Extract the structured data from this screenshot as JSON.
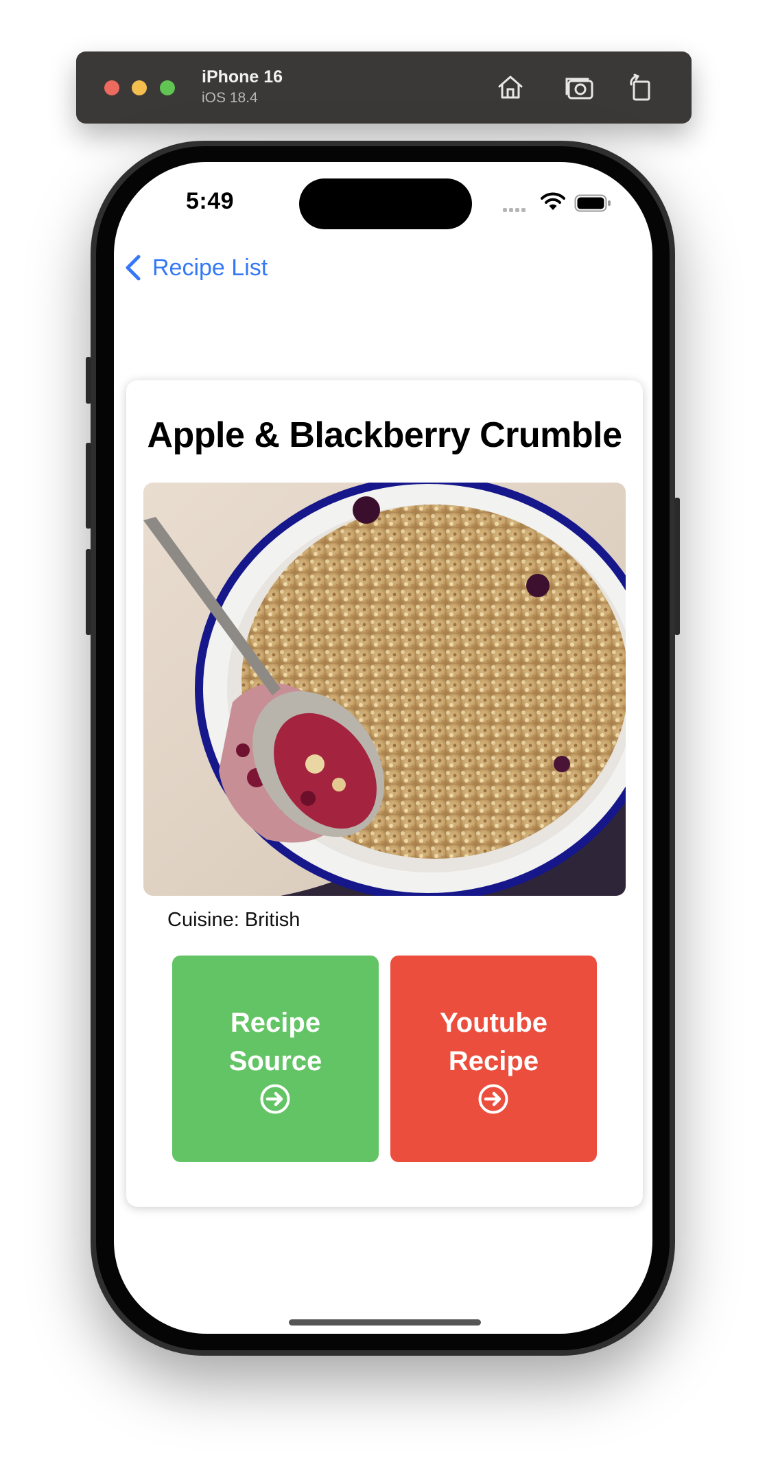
{
  "simulator": {
    "device_name": "iPhone 16",
    "os_version": "iOS 18.4",
    "toolbar_icons": [
      "home-icon",
      "screenshot-icon",
      "rotate-icon"
    ]
  },
  "status_bar": {
    "time": "5:49",
    "icons": [
      "cellular-signal-icon",
      "wifi-icon",
      "battery-icon"
    ]
  },
  "nav": {
    "back_label": "Recipe List",
    "back_icon": "chevron-left-icon",
    "accent_color": "#3478f6"
  },
  "recipe": {
    "title": "Apple & Blackberry Crumble",
    "cuisine_label": "Cuisine: British",
    "image": "recipe-photo-crumble"
  },
  "actions": [
    {
      "label": "Recipe Source",
      "icon": "arrow-circle-right-icon",
      "color": "#63c465"
    },
    {
      "label": "Youtube Recipe",
      "icon": "arrow-circle-right-icon",
      "color": "#ec4e3e"
    }
  ]
}
